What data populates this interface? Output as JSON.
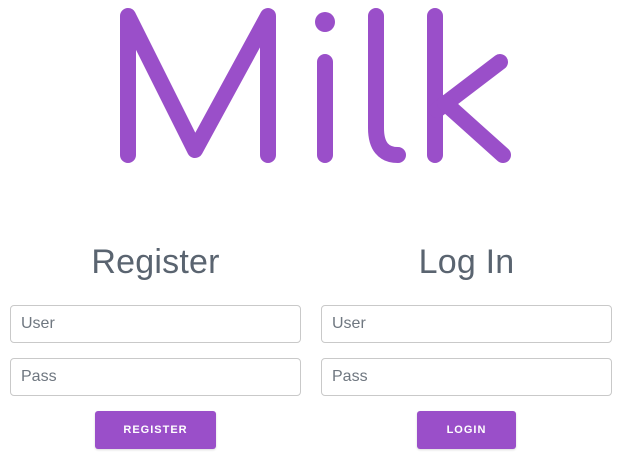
{
  "app": {
    "logo_text": "Milk",
    "accent_color": "#9a4fc9"
  },
  "register": {
    "heading": "Register",
    "user_placeholder": "User",
    "pass_placeholder": "Pass",
    "button_label": "REGISTER"
  },
  "login": {
    "heading": "Log In",
    "user_placeholder": "User",
    "pass_placeholder": "Pass",
    "button_label": "LOGIN"
  }
}
